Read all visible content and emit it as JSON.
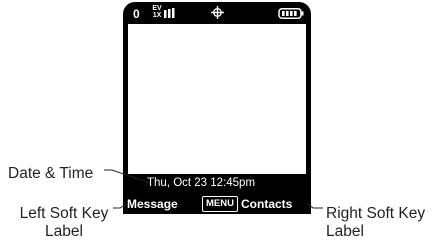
{
  "status_bar": {
    "digit": "0",
    "ev_icon": "ev-1x-network-icon",
    "signal_icon": "signal-strength-icon",
    "location_icon": "location-crosshair-icon",
    "battery_icon": "battery-full-icon"
  },
  "screen": {
    "datetime": "Thu, Oct 23 12:45pm"
  },
  "softkeys": {
    "left": "Message",
    "center": "MENU",
    "right": "Contacts"
  },
  "callouts": {
    "datetime": "Date & Time",
    "left_line1": "Left Soft Key",
    "left_line2": "Label",
    "right_line1": "Right Soft Key",
    "right_line2": "Label"
  },
  "colors": {
    "screen_bezel": "#000000",
    "display": "#ffffff",
    "text": "#222222"
  }
}
